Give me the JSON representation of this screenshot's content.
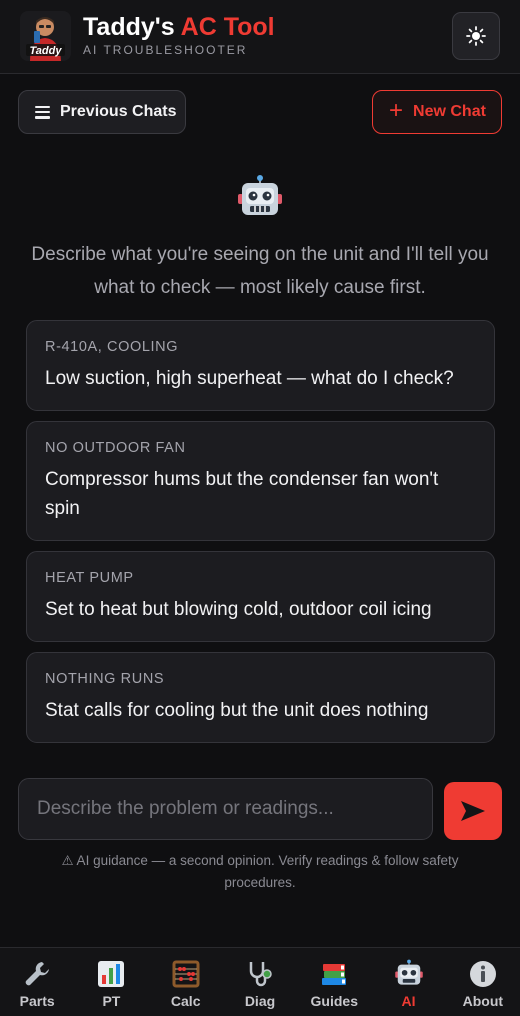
{
  "header": {
    "title_main": "Taddy's ",
    "title_accent": "AC Tool",
    "subtitle": "AI TROUBLESHOOTER",
    "logo_text": "Taddy",
    "theme_icon": "sun-icon",
    "accent_color": "#ef3b33"
  },
  "actions": {
    "previous_chats_label": "Previous Chats",
    "new_chat_label": "New Chat"
  },
  "intro": {
    "icon": "robot-icon",
    "text": "Describe what you're seeing on the unit and I'll tell you what to check — most likely cause first."
  },
  "suggestions": [
    {
      "tag": "R-410A, COOLING",
      "text": "Low suction, high superheat — what do I check?"
    },
    {
      "tag": "NO OUTDOOR FAN",
      "text": "Compressor hums but the condenser fan won't spin"
    },
    {
      "tag": "HEAT PUMP",
      "text": "Set to heat but blowing cold, outdoor coil icing"
    },
    {
      "tag": "NOTHING RUNS",
      "text": "Stat calls for cooling but the unit does nothing"
    }
  ],
  "composer": {
    "placeholder": "Describe the problem or readings...",
    "value": "",
    "send_icon": "send-arrow-icon"
  },
  "disclaimer": "⚠ AI guidance — a second opinion. Verify readings & follow safety procedures.",
  "nav": {
    "items": [
      {
        "label": "Parts",
        "icon": "wrench-icon"
      },
      {
        "label": "PT",
        "icon": "bar-chart-icon"
      },
      {
        "label": "Calc",
        "icon": "abacus-icon"
      },
      {
        "label": "Diag",
        "icon": "stethoscope-icon"
      },
      {
        "label": "Guides",
        "icon": "books-icon"
      },
      {
        "label": "AI",
        "icon": "robot-icon",
        "active": true
      },
      {
        "label": "About",
        "icon": "info-icon"
      }
    ]
  }
}
